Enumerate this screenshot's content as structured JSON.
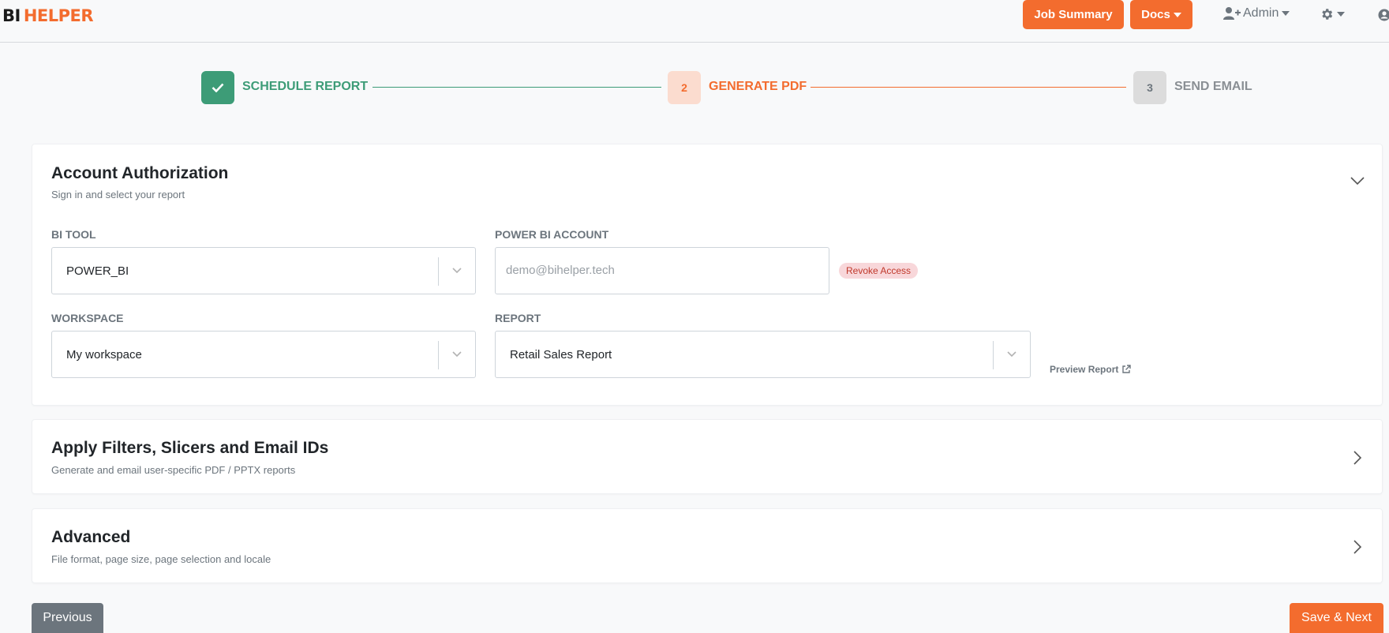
{
  "header": {
    "logo_bi": "BI",
    "logo_helper": "HELPER",
    "job_summary": "Job Summary",
    "docs": "Docs",
    "admin": "Admin",
    "brand_color": "#f36c2e"
  },
  "stepper": {
    "steps": [
      {
        "number": "",
        "label": "SCHEDULE REPORT",
        "state": "complete"
      },
      {
        "number": "2",
        "label": "GENERATE PDF",
        "state": "active"
      },
      {
        "number": "3",
        "label": "SEND EMAIL",
        "state": "pending"
      }
    ]
  },
  "sections": [
    {
      "title": "Account Authorization",
      "subtitle": "Sign in and select your report",
      "expanded": true
    },
    {
      "title": "Apply Filters, Slicers and Email IDs",
      "subtitle": "Generate and email user-specific PDF / PPTX reports",
      "expanded": false
    },
    {
      "title": "Advanced",
      "subtitle": "File format, page size, page selection and locale",
      "expanded": false
    }
  ],
  "auth": {
    "bi_tool_label": "BI TOOL",
    "bi_tool_value": "POWER_BI",
    "account_label": "POWER BI ACCOUNT",
    "account_placeholder": "demo@bihelper.tech",
    "revoke": "Revoke Access",
    "workspace_label": "WORKSPACE",
    "workspace_value": "My workspace",
    "report_label": "REPORT",
    "report_value": "Retail Sales Report",
    "preview": "Preview Report"
  },
  "footer": {
    "previous": "Previous",
    "save_next": "Save & Next"
  }
}
